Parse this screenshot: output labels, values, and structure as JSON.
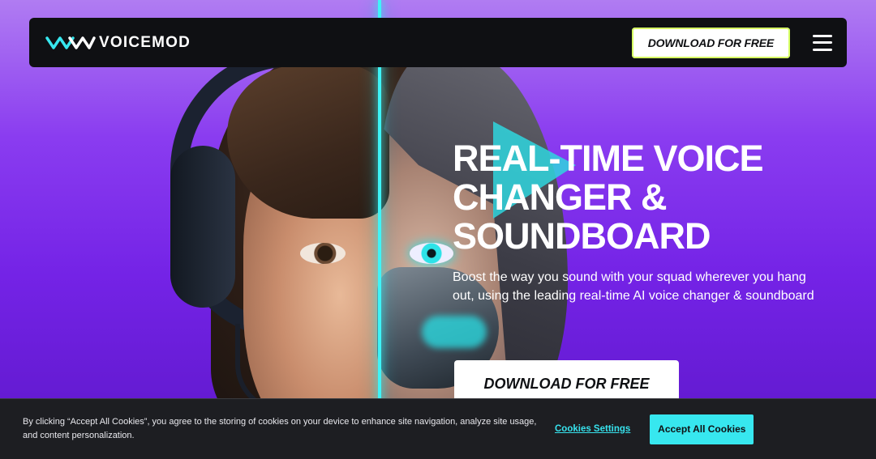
{
  "header": {
    "logo_text": "VOICEMOD",
    "cta_label": "DOWNLOAD FOR FREE",
    "menu_icon": "hamburger-menu-icon"
  },
  "hero": {
    "title": "REAL-TIME VOICE CHANGER & SOUNDBOARD",
    "subtitle": "Boost the way you sound with your squad wherever you hang out, using the leading real-time AI voice changer & soundboard",
    "cta_label": "DOWNLOAD FOR FREE"
  },
  "cookie_banner": {
    "text": "By clicking “Accept All Cookies”, you agree to the storing of cookies on your device to enhance site navigation, analyze site usage, and content personalization.",
    "settings_label": "Cookies Settings",
    "accept_label": "Accept All Cookies"
  },
  "colors": {
    "accent": "#37e7ef",
    "background_purple": "#7423e6",
    "header_bg": "#0f1013"
  }
}
